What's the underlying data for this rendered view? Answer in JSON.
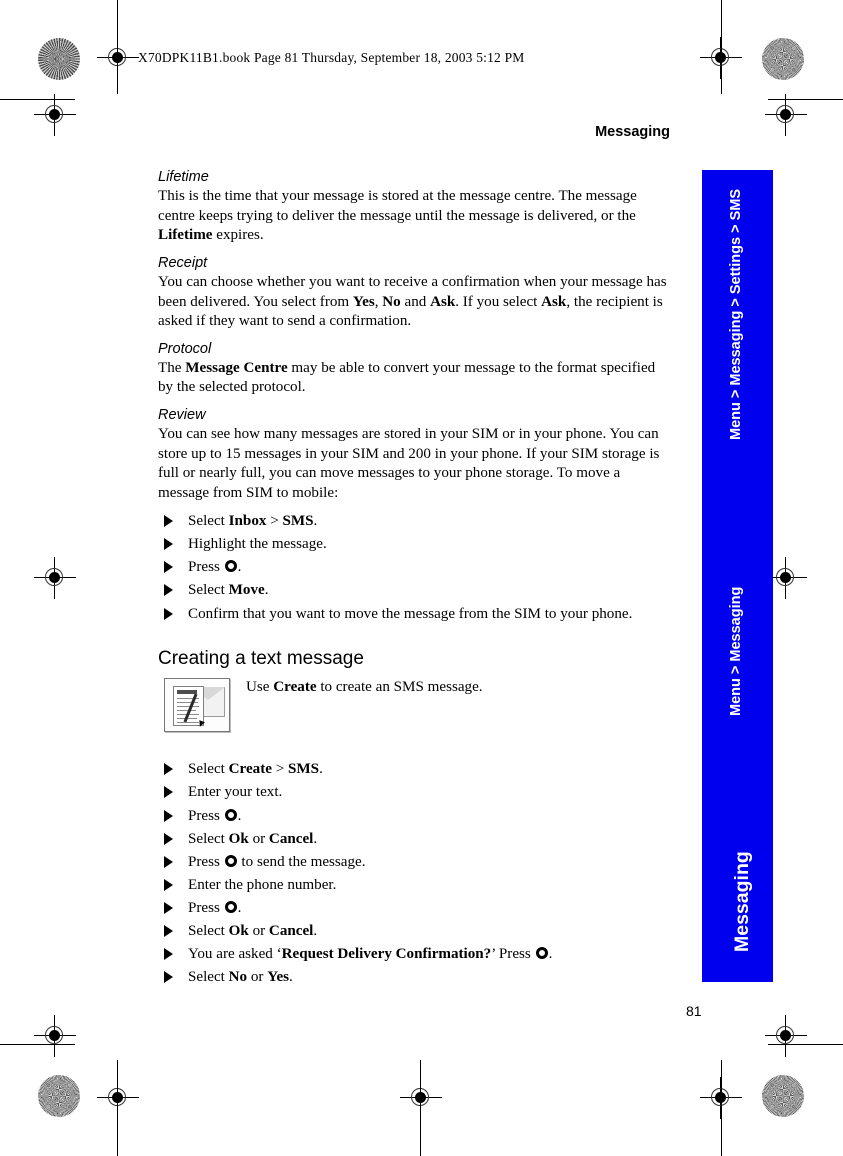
{
  "header": {
    "file_line": "X70DPK11B1.book  Page 81  Thursday, September 18, 2003  5:12 PM"
  },
  "running_head": "Messaging",
  "sections": {
    "lifetime": {
      "heading": "Lifetime",
      "para_a": "This is the time that your message is stored at the message centre. The message centre keeps trying to deliver the message until the message is delivered, or the ",
      "para_bold": "Lifetime",
      "para_b": " expires."
    },
    "receipt": {
      "heading": "Receipt",
      "para_a": "You can choose whether you want to receive a confirmation when your message has been delivered. You select from ",
      "yes": "Yes",
      "sep1": ", ",
      "no": "No",
      "sep2": " and ",
      "ask": "Ask",
      "para_b": ". If you select ",
      "ask2": "Ask",
      "para_c": ", the recipient is asked if they want to send a confirmation."
    },
    "protocol": {
      "heading": "Protocol",
      "para_a": "The ",
      "message_centre": "Message Centre",
      "para_b": " may be able to convert your message to the format specified by the selected protocol."
    },
    "review": {
      "heading": "Review",
      "para": "You can see how many messages are stored in your SIM or in your phone. You can store up to 15 messages in your SIM and 200 in your phone. If your SIM storage is full or nearly full, you can move messages to your phone storage. To move a message from SIM to mobile:"
    },
    "creating": {
      "heading": "Creating a text message",
      "caption_a": "Use ",
      "caption_bold": "Create",
      "caption_b": " to create an SMS message.",
      "figure_icon": "create-message-icon"
    }
  },
  "move_steps": [
    {
      "pre": "Select ",
      "b1": "Inbox",
      "mid": " > ",
      "b2": "SMS",
      "post": "."
    },
    {
      "pre": "Highlight the message.",
      "b1": "",
      "mid": "",
      "b2": "",
      "post": ""
    },
    {
      "pre": "Press ",
      "key": "select-key",
      "post": "."
    },
    {
      "pre": "Select ",
      "b1": "Move",
      "post": "."
    },
    {
      "pre": "Confirm that you want to move the message from the SIM to your phone.",
      "post": ""
    }
  ],
  "create_steps": [
    {
      "pre": "Select ",
      "b1": "Create",
      "mid": " > ",
      "b2": "SMS",
      "post": "."
    },
    {
      "pre": "Enter your text.",
      "post": ""
    },
    {
      "pre": "Press ",
      "key": "select-key",
      "post": "."
    },
    {
      "pre": "Select ",
      "b1": "Ok",
      "mid": " or ",
      "b2": "Cancel",
      "post": "."
    },
    {
      "pre": "Press ",
      "key": "select-key",
      "post": " to send the message."
    },
    {
      "pre": "Enter the phone number.",
      "post": ""
    },
    {
      "pre": "Press ",
      "key": "select-key",
      "post": "."
    },
    {
      "pre": "Select ",
      "b1": "Ok",
      "mid": " or ",
      "b2": "Cancel",
      "post": "."
    },
    {
      "pre": "You are asked ‘",
      "b1": "Request Delivery Confirmation?",
      "mid": "’ Press ",
      "key": "select-key",
      "post": "."
    },
    {
      "pre": "Select ",
      "b1": "No",
      "mid": " or ",
      "b2": "Yes",
      "post": "."
    }
  ],
  "side_tab": {
    "color": "#0000EE",
    "labels": [
      "Menu > Messaging > Settings > SMS",
      "Menu > Messaging",
      "Messaging"
    ]
  },
  "folio": "81",
  "marks": {
    "registration": "registration-target",
    "star": "star-rosette"
  }
}
